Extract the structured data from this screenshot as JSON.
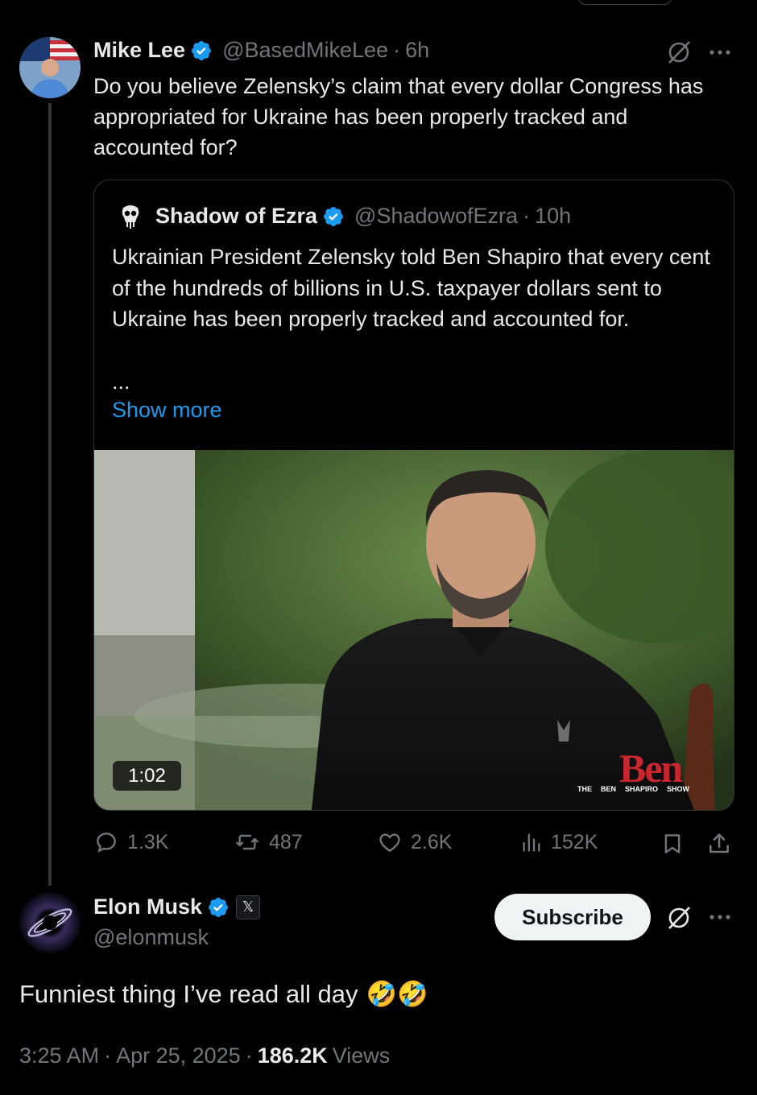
{
  "parent_tweet": {
    "author_name": "Mike Lee",
    "handle": "@BasedMikeLee",
    "separator": "·",
    "time": "6h",
    "text": "Do you believe Zelensky’s claim that every dollar Congress has appropriated for Ukraine has been properly tracked and accounted for?",
    "quote": {
      "author_name": "Shadow of Ezra",
      "handle": "@ShadowofEzra",
      "separator": "·",
      "time": "10h",
      "text": "Ukrainian President Zelensky told Ben Shapiro that every cent of the hundreds of billions in U.S. taxpayer dollars sent to Ukraine has been properly tracked and accounted for.",
      "ellipsis": "...",
      "show_more": "Show more",
      "video_duration": "1:02",
      "watermark": {
        "logo_text": "Ben",
        "show_words": [
          "THE",
          "BEN",
          "SHAPIRO",
          "SHOW"
        ]
      }
    },
    "stats": {
      "replies": "1.3K",
      "reposts": "487",
      "likes": "2.6K",
      "views": "152K"
    }
  },
  "main_tweet": {
    "author_name": "Elon Musk",
    "handle": "@elonmusk",
    "affiliate_badge": "𝕏",
    "subscribe_label": "Subscribe",
    "text": "Funniest thing I’ve read all day",
    "emojis": "🤣🤣",
    "time": "3:25 AM",
    "date": "Apr 25, 2025",
    "separator": "·",
    "views_count": "186.2K",
    "views_label": "Views"
  },
  "colors": {
    "background": "#000000",
    "primary_text": "#e7e9ea",
    "secondary_text": "#71767b",
    "link": "#1d9bf0",
    "verified": "#1d9bf0",
    "border": "#2f3336"
  }
}
